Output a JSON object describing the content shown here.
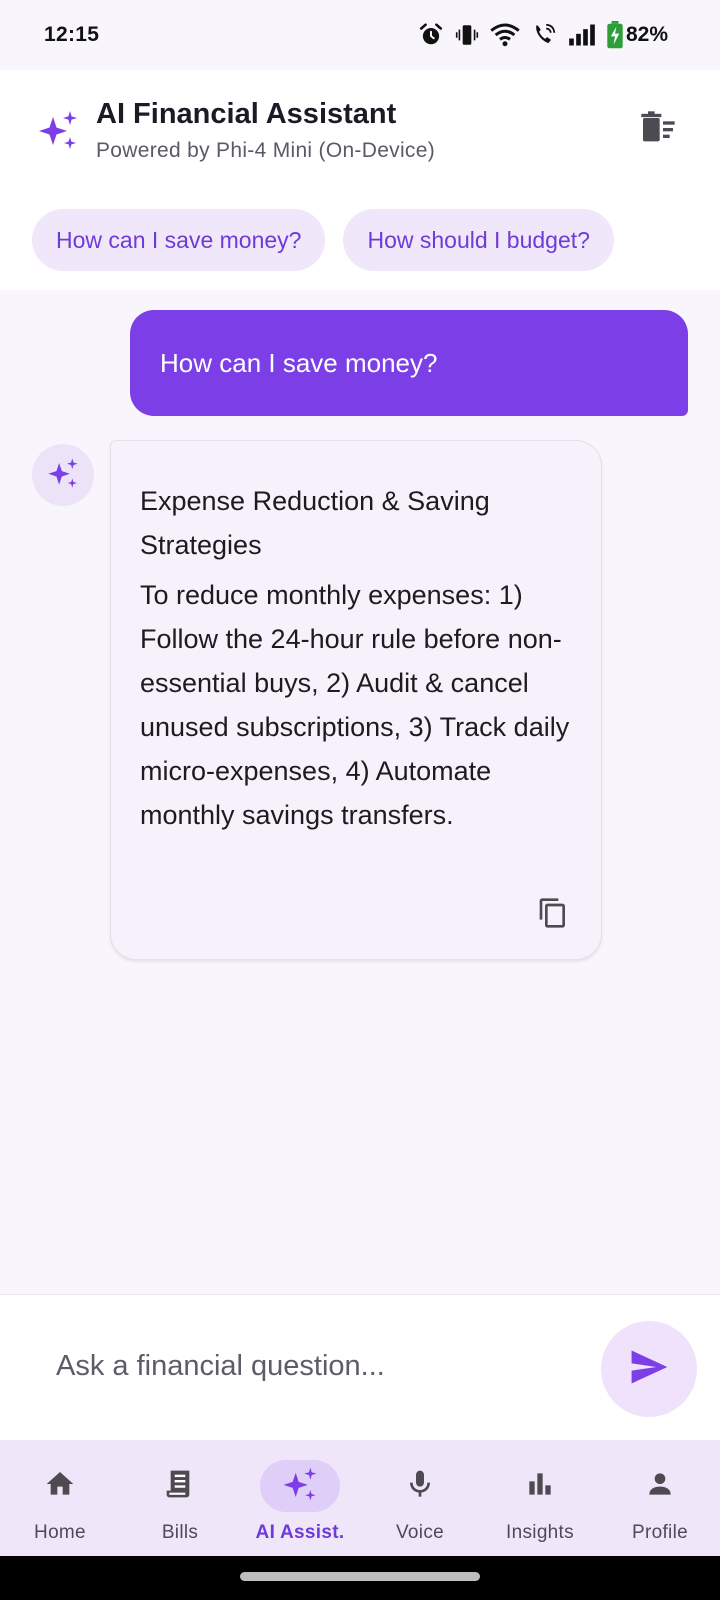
{
  "status_bar": {
    "time": "12:15",
    "battery": "82%",
    "icons": [
      "alarm-icon",
      "vibrate-icon",
      "wifi-icon",
      "wifi-calling-icon",
      "signal-icon",
      "battery-charging-icon"
    ]
  },
  "header": {
    "title": "AI Financial Assistant",
    "subtitle": "Powered by Phi-4 Mini (On-Device)",
    "icon": "sparkle-icon",
    "action_icon": "delete-sweep-icon"
  },
  "suggestions": [
    {
      "label": "How can I save money?"
    },
    {
      "label": "How should I budget?"
    }
  ],
  "chat": {
    "user_message": "How can I save money?",
    "ai_title": "Expense Reduction & Saving Strategies",
    "ai_body": "To reduce monthly expenses: 1) Follow the 24-hour rule before non-essential buys, 2) Audit & cancel unused subscriptions, 3) Track daily micro-expenses, 4) Automate monthly savings transfers.",
    "copy_icon": "copy-icon"
  },
  "input": {
    "placeholder": "Ask a financial question...",
    "value": "",
    "send_icon": "send-icon"
  },
  "nav": {
    "items": [
      {
        "label": "Home",
        "icon": "home-icon"
      },
      {
        "label": "Bills",
        "icon": "receipt-icon"
      },
      {
        "label": "AI Assist.",
        "icon": "sparkle-icon",
        "active": true
      },
      {
        "label": "Voice",
        "icon": "mic-icon"
      },
      {
        "label": "Insights",
        "icon": "bar-chart-icon"
      },
      {
        "label": "Profile",
        "icon": "person-icon"
      }
    ]
  },
  "colors": {
    "accent": "#7c3ee6",
    "accent_text": "#6f3bd8",
    "chip_bg": "#f0e7fb",
    "nav_bg": "#efe7f9",
    "battery_green": "#2e9d3a"
  }
}
